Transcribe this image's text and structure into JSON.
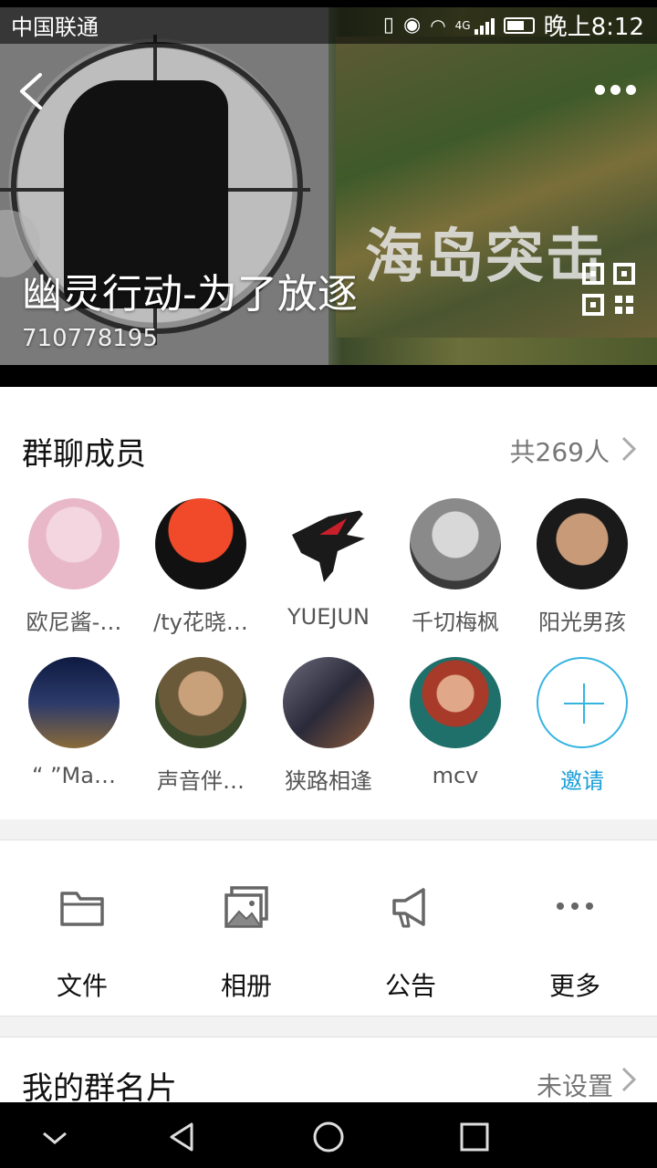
{
  "status_bar": {
    "carrier": "中国联通",
    "network": "4G",
    "time": "晚上8:12"
  },
  "header": {
    "group_name": "幽灵行动-为了放逐",
    "group_id": "710778195",
    "banner_overlay_text": "海岛突击",
    "icons": {
      "back": "back-arrow-icon",
      "more": "more-dots-icon",
      "qr": "qr-code-icon"
    }
  },
  "members": {
    "title": "群聊成员",
    "count": "共269人",
    "list": [
      {
        "name": "欧尼酱-…",
        "avatar_color": "#e8b8c8"
      },
      {
        "name": "/ty花晓…",
        "avatar_color": "#d83a2a"
      },
      {
        "name": "YUEJUN",
        "avatar_color": "#ffffff"
      },
      {
        "name": "千切梅枫",
        "avatar_color": "#6f6f6f"
      },
      {
        "name": "阳光男孩",
        "avatar_color": "#2a2a2a"
      },
      {
        "name": "“ ”Ma…",
        "avatar_color": "#2b3a6a"
      },
      {
        "name": "声音伴…",
        "avatar_color": "#8a7a5a"
      },
      {
        "name": "狭路相逢",
        "avatar_color": "#4a4a5a"
      },
      {
        "name": "mcv",
        "avatar_color": "#1f6f6a"
      }
    ],
    "invite_label": "邀请",
    "accent_color": "#1a9fd8"
  },
  "tools": [
    {
      "label": "文件",
      "icon": "folder-icon"
    },
    {
      "label": "相册",
      "icon": "photo-album-icon"
    },
    {
      "label": "公告",
      "icon": "megaphone-icon"
    },
    {
      "label": "更多",
      "icon": "more-dots-icon"
    }
  ],
  "my_card": {
    "title": "我的群名片",
    "value": "未设置"
  }
}
